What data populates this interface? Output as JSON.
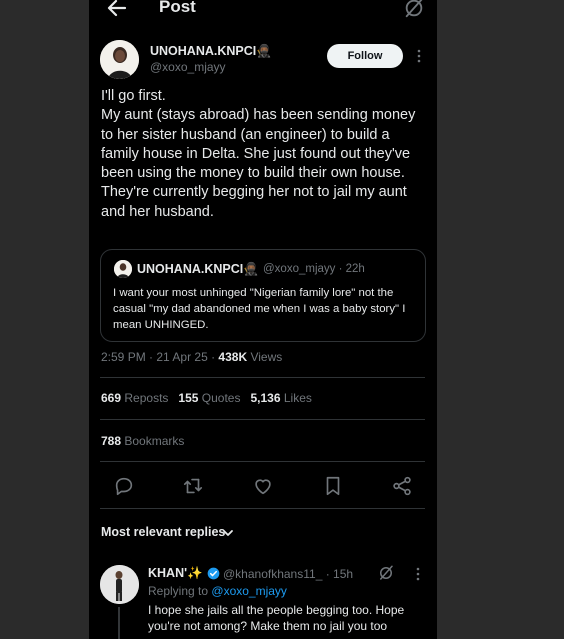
{
  "header": {
    "title": "Post"
  },
  "post": {
    "author_name": "UNOHANA.KNPCI🥷🏾",
    "author_handle": "@xoxo_mjayy",
    "follow_label": "Follow",
    "body": [
      "I'll go first.",
      "My aunt (stays abroad) has been sending money to her sister husband (an engineer) to build a family house in Delta. She just found out they've been using the money to build their own house.",
      "They're currently begging her not to jail my aunt and her husband."
    ],
    "quote": {
      "author_name": "UNOHANA.KNPCI🥷🏾",
      "author_handle": "@xoxo_mjayy",
      "time": "· 22h",
      "text": "I want your most unhinged \"Nigerian family lore\" not the casual \"my dad abandoned me when I was a baby story\" I mean UNHINGED."
    },
    "meta": {
      "time": "2:59 PM",
      "date": "21 Apr 25",
      "views_count": "438K",
      "views_label": "Views"
    },
    "stats": {
      "reposts_count": "669",
      "reposts_label": "Reposts",
      "quotes_count": "155",
      "quotes_label": "Quotes",
      "likes_count": "5,136",
      "likes_label": "Likes",
      "bookmarks_count": "788",
      "bookmarks_label": "Bookmarks"
    }
  },
  "actions": [
    "reply-icon",
    "repost-icon",
    "like-icon",
    "bookmark-icon",
    "share-icon"
  ],
  "replies_filter": {
    "label": "Most relevant replies"
  },
  "reply": {
    "author_name": "KHAN'✨",
    "author_handle": "@khanofkhans11_",
    "time": "· 15h",
    "replying_prefix": "Replying to",
    "replying_handle": "@xoxo_mjayy",
    "text": "I hope she jails all the people begging too. Hope you're not among? Make them no jail you too"
  },
  "colors": {
    "background": "#000000",
    "accent": "#1d9bf0",
    "muted": "#71767b",
    "text": "#e7e9ea",
    "border": "#2f3336"
  }
}
